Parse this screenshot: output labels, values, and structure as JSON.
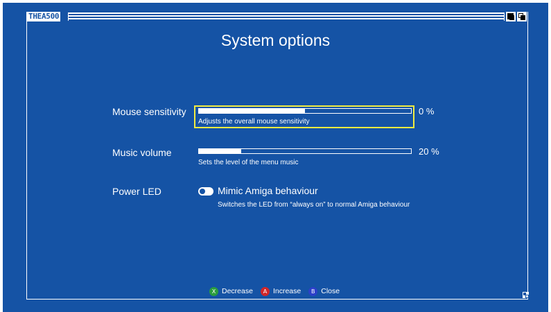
{
  "window": {
    "title": "THEA500"
  },
  "page": {
    "title": "System options"
  },
  "options": {
    "mouse_sensitivity": {
      "label": "Mouse sensitivity",
      "value_text": "0 %",
      "level": 0.5,
      "description": "Adjusts the overall mouse sensitivity"
    },
    "music_volume": {
      "label": "Music volume",
      "value_text": "20 %",
      "level": 0.2,
      "description": "Sets the level of the menu music"
    },
    "power_led": {
      "label": "Power LED",
      "toggle_text": "Mimic Amiga behaviour",
      "toggle_on": true,
      "description": "Switches the LED from “always on” to normal Amiga behaviour"
    }
  },
  "footer": {
    "decrease": {
      "glyph": "X",
      "label": "Decrease",
      "color": "#2a9d3e"
    },
    "increase": {
      "glyph": "A",
      "label": "Increase",
      "color": "#d0262a"
    },
    "close": {
      "glyph": "B",
      "label": "Close",
      "color": "#2c3fc9"
    }
  },
  "colors": {
    "background": "#1553a5",
    "focus": "#f2ec40",
    "foreground": "#ffffff"
  },
  "icons": {
    "depth_front": "depth-gadget-icon",
    "depth_back": "depth-gadget-icon",
    "resize": "resize-gadget-icon"
  }
}
